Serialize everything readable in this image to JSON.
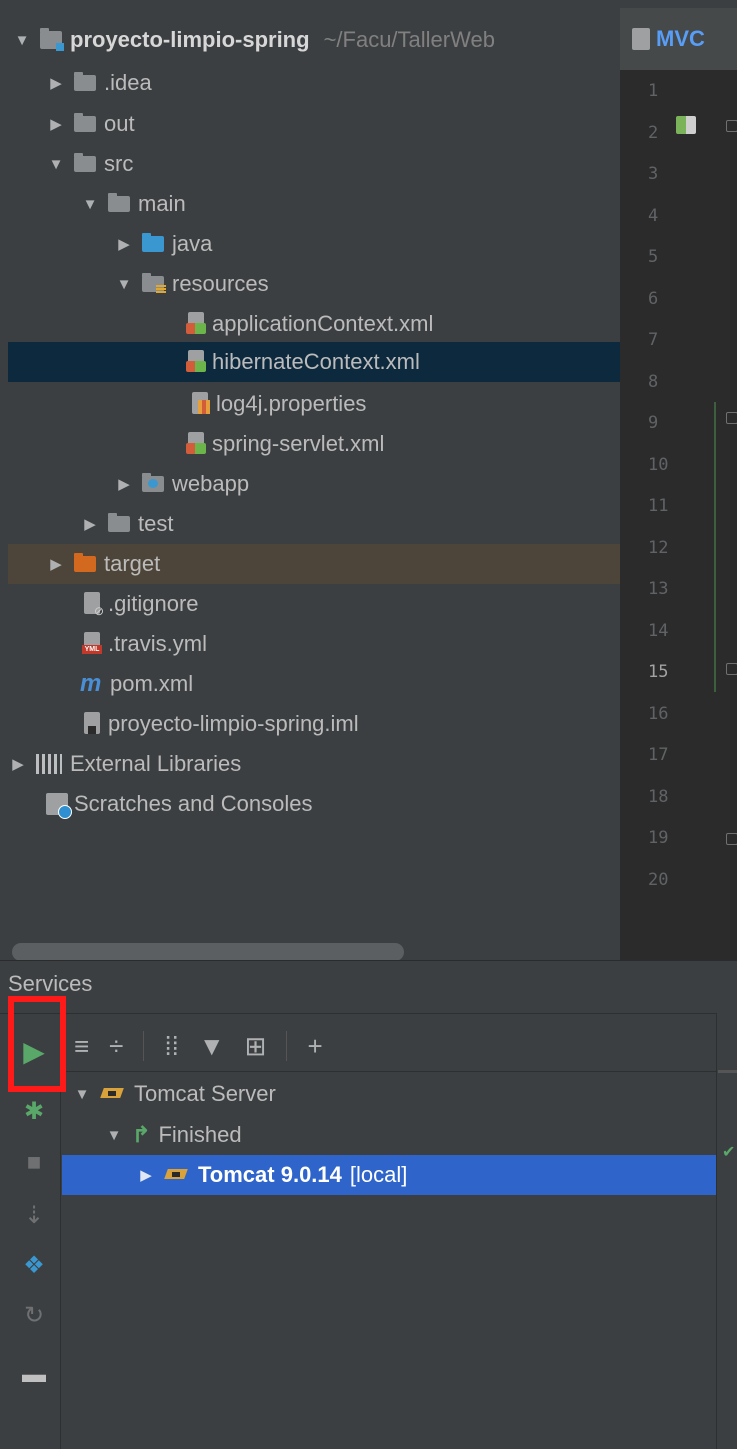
{
  "project_tree": {
    "root": {
      "label": "proyecto-limpio-spring",
      "path": "~/Facu/TallerWeb"
    },
    "items": [
      {
        "label": ".idea"
      },
      {
        "label": "out"
      },
      {
        "label": "src"
      },
      {
        "label": "main"
      },
      {
        "label": "java"
      },
      {
        "label": "resources"
      },
      {
        "label": "applicationContext.xml"
      },
      {
        "label": "hibernateContext.xml"
      },
      {
        "label": "log4j.properties"
      },
      {
        "label": "spring-servlet.xml"
      },
      {
        "label": "webapp"
      },
      {
        "label": "test"
      },
      {
        "label": "target"
      },
      {
        "label": ".gitignore"
      },
      {
        "label": ".travis.yml"
      },
      {
        "label": "pom.xml"
      },
      {
        "label": "proyecto-limpio-spring.iml"
      },
      {
        "label": "External Libraries"
      },
      {
        "label": "Scratches and Consoles"
      }
    ],
    "selected_item": "hibernateContext.xml"
  },
  "editor": {
    "tab_label": "MVC",
    "line_numbers": [
      "1",
      "2",
      "3",
      "4",
      "5",
      "6",
      "7",
      "8",
      "9",
      "10",
      "11",
      "12",
      "13",
      "14",
      "15",
      "16",
      "17",
      "18",
      "19",
      "20"
    ],
    "current_line": "15"
  },
  "services": {
    "title": "Services",
    "toolbar_icons": [
      "expand-all-icon",
      "collapse-all-icon",
      "group-by-icon",
      "filter-icon",
      "new-tab-icon",
      "add-service-icon"
    ],
    "tree": {
      "server_label": "Tomcat Server",
      "status_label": "Finished",
      "instance_label": "Tomcat 9.0.14",
      "instance_tag": "[local]"
    }
  },
  "colors": {
    "panel_bg": "#3c3f41",
    "editor_bg": "#2b2b2b",
    "selection_blue": "#2f65ca",
    "tree_selection": "#0d293e",
    "run_green": "#59a869",
    "highlight_red": "#ff1a1a"
  }
}
